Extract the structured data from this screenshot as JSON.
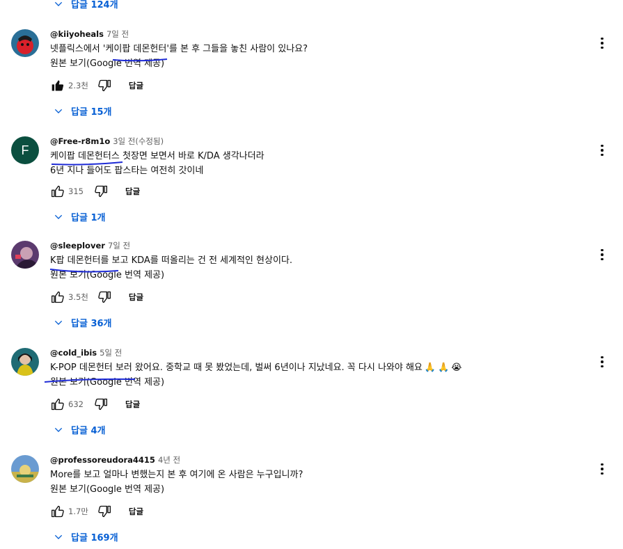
{
  "top_replies": {
    "label": "답글 124개"
  },
  "comments": [
    {
      "author": "@kiiyoheals",
      "time": "7일 전",
      "text_lines": [
        "넷플릭스에서 '케이팝 데몬헌터'를 본 후 그들을 놓친 사람이 있나요?"
      ],
      "translate": "원본 보기(Google 번역 제공)",
      "likes": "2.3천",
      "liked": true,
      "reply_label": "답글",
      "replies_label": "답글 15개",
      "avatar_color": "#2a6f97"
    },
    {
      "author": "@Free-r8m1o",
      "time": "3일 전(수정됨)",
      "text_lines": [
        "케이팝 데몬헌터스 첫장면 보면서 바로 K/DA 생각나더라",
        "6년 지나 들어도 팝스타는 여전히 갓이네"
      ],
      "likes": "315",
      "liked": false,
      "reply_label": "답글",
      "replies_label": "답글 1개",
      "avatar_letter": "F",
      "avatar_color": "#0b4f3f"
    },
    {
      "author": "@sleeplover",
      "time": "7일 전",
      "text_lines": [
        "K팝 데몬헌터를 보고 KDA를 떠올리는 건 전 세계적인 현상이다."
      ],
      "translate": "원본 보기(Google 번역 제공)",
      "likes": "3.5천",
      "liked": false,
      "reply_label": "답글",
      "replies_label": "답글 36개",
      "avatar_color": "#5b3a6e"
    },
    {
      "author": "@cold_ibis",
      "time": "5일 전",
      "text_lines": [
        "K-POP 데몬헌터 보러 왔어요. 중학교 때 못 봤었는데, 벌써 6년이나 지났네요. 꼭 다시 나와야 해요"
      ],
      "emojis": [
        "🙏",
        "🙏",
        "😭"
      ],
      "translate": "원본 보기(Google 번역 제공)",
      "likes": "632",
      "liked": false,
      "reply_label": "답글",
      "replies_label": "답글 4개",
      "avatar_color": "#1f6b74"
    },
    {
      "author": "@professoreudora4415",
      "time": "4년 전",
      "text_lines": [
        "More를 보고 얼마나 변했는지 본 후 여기에 온 사람은 누구입니까?"
      ],
      "translate": "원본 보기(Google 번역 제공)",
      "likes": "1.7만",
      "liked": false,
      "reply_label": "답글",
      "replies_label": "답글 169개",
      "avatar_color": "#6a9bd1"
    }
  ],
  "colors": {
    "link_blue": "#065fd4",
    "ink_underline": "#1e2bd6"
  }
}
